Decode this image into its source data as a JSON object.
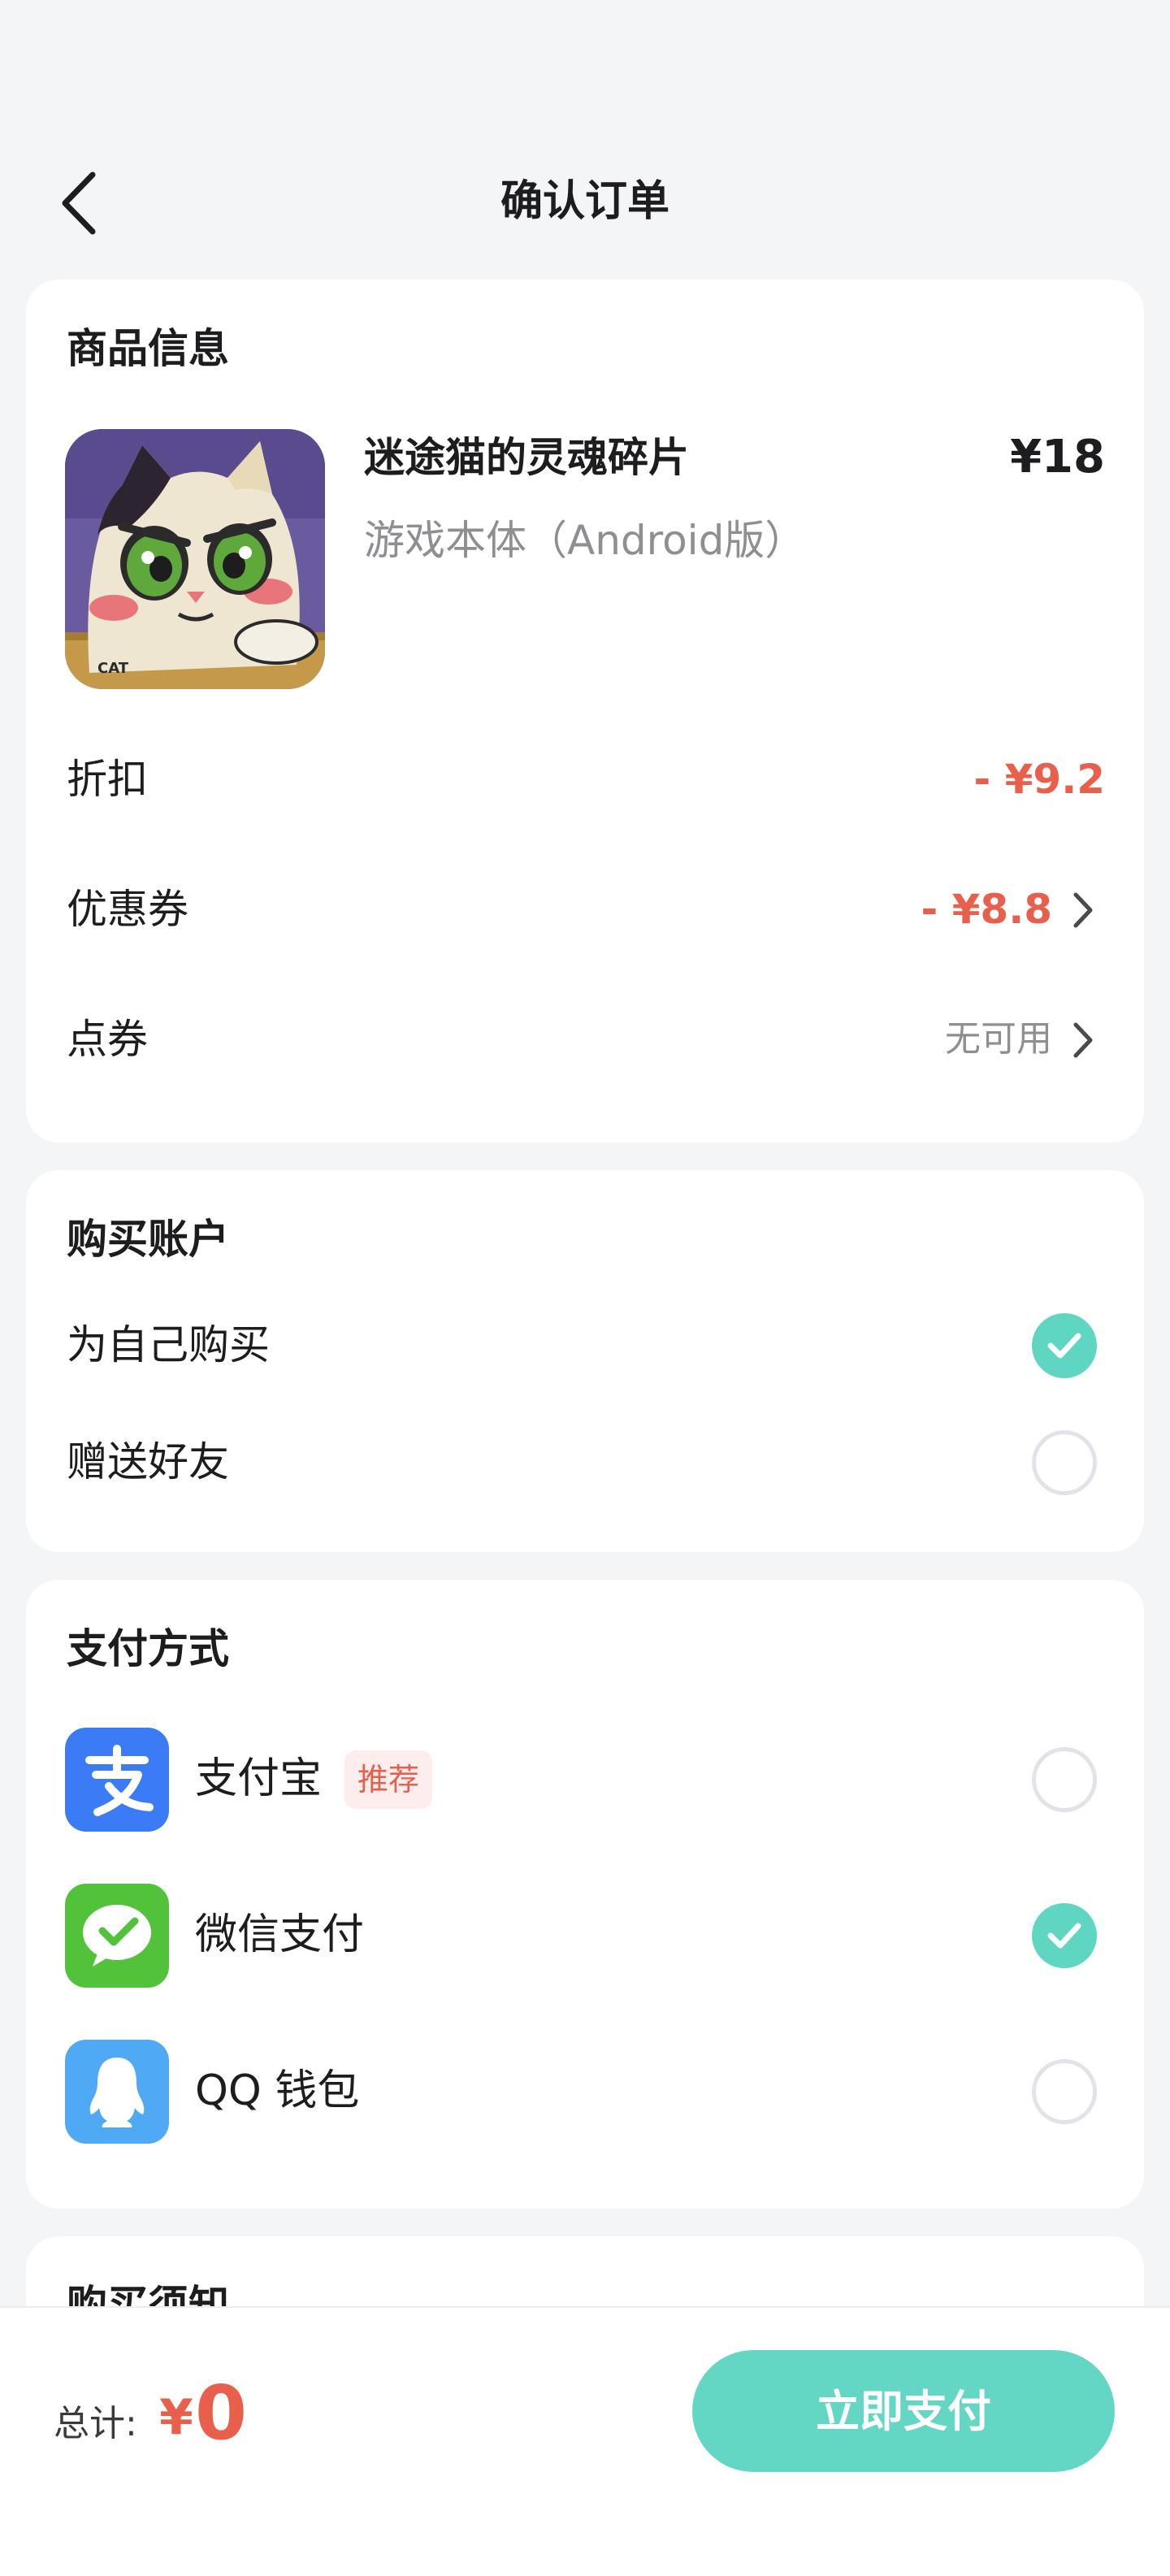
{
  "header": {
    "title": "确认订单"
  },
  "product_card": {
    "section_title": "商品信息",
    "game_name": "迷途猫的灵魂碎片",
    "game_edition": "游戏本体（Android版）",
    "price": "¥18",
    "cover_text": "CAT",
    "discount": {
      "label": "折扣",
      "value": "- ¥9.2"
    },
    "coupon": {
      "label": "优惠券",
      "value": "- ¥8.8"
    },
    "points_coupon": {
      "label": "点券",
      "value": "无可用"
    }
  },
  "account_card": {
    "section_title": "购买账户",
    "options": [
      {
        "label": "为自己购买",
        "selected": true
      },
      {
        "label": "赠送好友",
        "selected": false
      }
    ]
  },
  "payment_card": {
    "section_title": "支付方式",
    "methods": [
      {
        "label": "支付宝",
        "badge": "推荐",
        "icon": "alipay-icon",
        "color": "#3b7cf6",
        "selected": false
      },
      {
        "label": "微信支付",
        "icon": "wechat-pay-icon",
        "color": "#52c23a",
        "selected": true
      },
      {
        "label": "QQ 钱包",
        "icon": "qq-wallet-icon",
        "color": "#4fa9f5",
        "selected": false
      }
    ]
  },
  "notice_card": {
    "section_title": "购买须知"
  },
  "footer": {
    "total_label": "总计:",
    "currency": "¥",
    "total_value": "0",
    "pay_button": "立即支付"
  },
  "colors": {
    "accent": "#5ed6c2",
    "price_red": "#e8604c",
    "background": "#f4f5f7"
  }
}
